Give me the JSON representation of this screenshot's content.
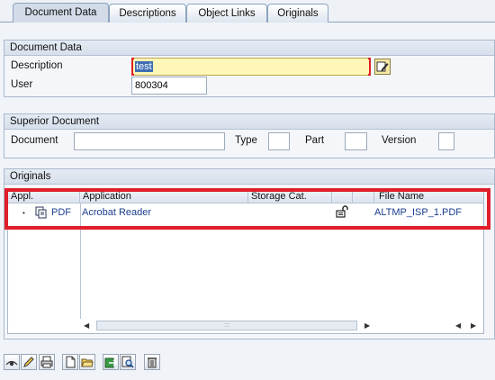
{
  "tabs": [
    {
      "label": "Document Data",
      "active": true
    },
    {
      "label": "Descriptions",
      "active": false
    },
    {
      "label": "Object Links",
      "active": false
    },
    {
      "label": "Originals",
      "active": false
    }
  ],
  "document_data": {
    "title": "Document Data",
    "description_label": "Description",
    "description_value": "test",
    "user_label": "User",
    "user_value": "800304"
  },
  "superior_document": {
    "title": "Superior Document",
    "document_label": "Document",
    "document_value": "",
    "type_label": "Type",
    "type_value": "",
    "part_label": "Part",
    "part_value": "",
    "version_label": "Version",
    "version_value": ""
  },
  "originals": {
    "title": "Originals",
    "columns": [
      "Appl.",
      "Application",
      "Storage Cat.",
      "",
      "",
      "File Name"
    ],
    "rows": [
      {
        "appl": "PDF",
        "application": "Acrobat Reader",
        "storage_cat": "",
        "file_name": "ALTMP_ISP_1.PDF"
      }
    ],
    "scroll_thumb_text": ":::"
  },
  "toolbar_icons": [
    "display-icon",
    "change-icon",
    "print-icon",
    "new-original-icon",
    "open-folder-icon",
    "checkin-icon",
    "find-icon",
    "delete-icon"
  ],
  "colors": {
    "highlight_box": "#e01e2a",
    "link_text": "#1b3d8f",
    "required_field": "#fff7b8"
  }
}
